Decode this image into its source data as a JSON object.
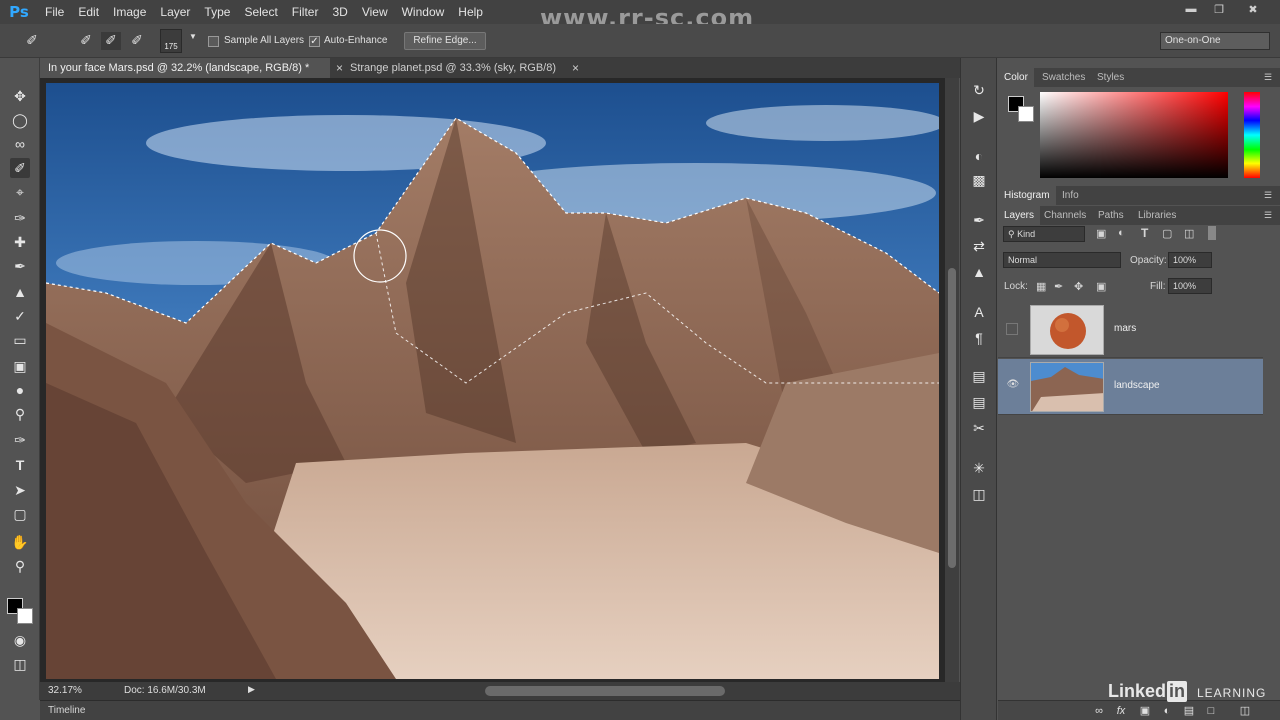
{
  "app": {
    "logo": "Ps",
    "menus": [
      "File",
      "Edit",
      "Image",
      "Layer",
      "Type",
      "Select",
      "Filter",
      "3D",
      "View",
      "Window",
      "Help"
    ],
    "watermark_url": "www.rr-sc.com"
  },
  "options_bar": {
    "brush_size": "175",
    "sample_all_layers": "Sample All Layers",
    "auto_enhance": "Auto-Enhance",
    "refine_edge": "Refine Edge...",
    "workspace": "One-on-One"
  },
  "tabs": [
    {
      "label": "In your face Mars.psd @ 32.2% (landscape, RGB/8) *",
      "active": true
    },
    {
      "label": "Strange planet.psd @ 33.3% (sky, RGB/8)",
      "active": false
    }
  ],
  "status": {
    "zoom": "32.17%",
    "doc": "Doc: 16.6M/30.3M",
    "timeline": "Timeline"
  },
  "panels": {
    "color_tabs": [
      "Color",
      "Swatches",
      "Styles"
    ],
    "histogram_tabs": [
      "Histogram",
      "Info"
    ],
    "layers_tabs": [
      "Layers",
      "Channels",
      "Paths",
      "Libraries"
    ],
    "kind": "Kind",
    "blend_mode": "Normal",
    "opacity_label": "Opacity:",
    "opacity_value": "100%",
    "lock_label": "Lock:",
    "fill_label": "Fill:",
    "fill_value": "100%",
    "layers": [
      {
        "name": "mars",
        "visible": false,
        "selected": false
      },
      {
        "name": "landscape",
        "visible": true,
        "selected": true
      }
    ]
  },
  "branding": {
    "linkedin": "Linked",
    "linkedin_in": "in",
    "learning": "LEARNING"
  },
  "colors": {
    "accent": "#31a8ff",
    "selected_layer": "#6c7f99"
  }
}
